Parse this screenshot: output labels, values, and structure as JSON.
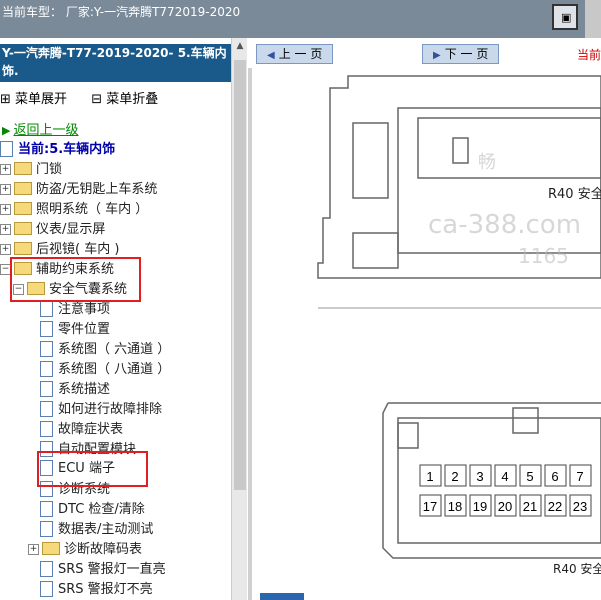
{
  "topbar": {
    "title": "当前车型： 厂家:Y-一汽奔腾T772019-2020"
  },
  "sidebar": {
    "header_line1": "Y-一汽奔腾-T77-2019-2020- 5.车辆内",
    "header_line2": "饰.",
    "expand_label": "菜单展开",
    "collapse_label": "菜单折叠",
    "back_label": "返回上一级",
    "current_label": "当前:5.车辆内饰",
    "folders": [
      "门锁",
      "防盗/无钥匙上车系统",
      "照明系统（ 车内 ）",
      "仪表/显示屏",
      "后视镜( 车内 )",
      "辅助约束系统"
    ],
    "subfolder": "安全气囊系统",
    "items": [
      "注意事项",
      "零件位置",
      "系统图（ 六通道 ）",
      "系统图（ 八通道 ）",
      "系统描述",
      "如何进行故障排除",
      "故障症状表",
      "自动配置模块",
      "ECU 端子",
      "诊断系统",
      "DTC 检查/清除",
      "数据表/主动测试"
    ],
    "subfolder2": "诊断故障码表",
    "items2": [
      "SRS 警报灯一直亮",
      "SRS 警报灯不亮"
    ]
  },
  "viewer": {
    "prev_label": "上 一 页",
    "next_label": "下 一 页",
    "current_label": "当前",
    "connector_label_top": "R40 安全",
    "connector_label_bottom": "R40 安全",
    "watermark_1": "畅",
    "watermark_2": "ca-388.com",
    "watermark_3": "1165",
    "pins_row1": [
      "1",
      "2",
      "3",
      "4",
      "5",
      "6",
      "7"
    ],
    "pins_row2": [
      "17",
      "18",
      "19",
      "20",
      "21",
      "22",
      "23"
    ]
  },
  "colors": {
    "topbar": "#7a8a99",
    "header": "#1a5a8a",
    "highlight_box": "#e02020",
    "link": "#008800"
  }
}
